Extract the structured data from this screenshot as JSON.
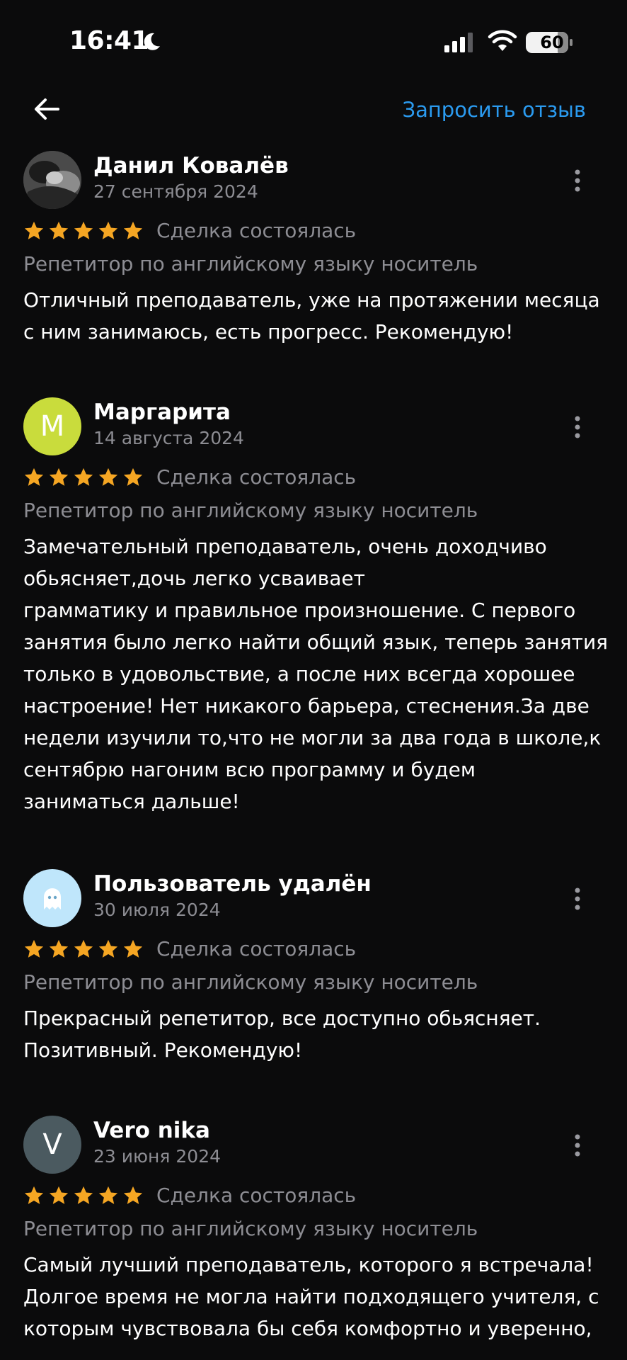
{
  "status_bar": {
    "time": "16:41",
    "battery": "60",
    "icons": [
      "moon-icon",
      "signal-icon",
      "wifi-icon",
      "battery-icon"
    ]
  },
  "header": {
    "back_icon": "arrow-left-icon",
    "request_review": "Запросить отзыв",
    "accent_color": "#2b9bf0"
  },
  "colors": {
    "background": "#0b0b0c",
    "star": "#f5a623",
    "muted_text": "#8d8d93"
  },
  "reviews": [
    {
      "author": "Данил Ковалёв",
      "date": "27 сентября 2024",
      "rating": 5,
      "deal_status": "Сделка состоялась",
      "category": "Репетитор по английскому языку носитель",
      "text": "Отличный преподаватель, уже на протяжении месяца\nс ним занимаюсь, есть прогресс. Рекомендую!",
      "avatar_type": "photo"
    },
    {
      "author": "Маргарита",
      "date": "14 августа 2024",
      "rating": 5,
      "deal_status": "Сделка состоялась",
      "category": "Репетитор по английскому языку носитель",
      "text": "Замечательный преподаватель, очень доходчиво\nобьясняет,дочь легко усваивает\nграмматику и правильное произношение. С первого\nзанятия было легко найти общий язык, теперь занятия\nтолько в удовольствие, а после них всегда хорошее\nнастроение! Нет никакого барьера, стеснения.За две\nнедели изучили то,что не могли за два года в школе,к\nсентябрю нагоним всю программу и будем\nзаниматься дальше!",
      "avatar_letter": "M",
      "avatar_color": "#c9dc3c"
    },
    {
      "author": "Пользователь удалён",
      "date": "30 июля 2024",
      "rating": 5,
      "deal_status": "Сделка состоялась",
      "category": "Репетитор по английскому языку носитель",
      "text": "Прекрасный репетитор, все доступно обьясняет.\nПозитивный. Рекомендую!",
      "avatar_type": "ghost-icon",
      "avatar_color": "#bfe6fb"
    },
    {
      "author": "Vero nika",
      "date": "23 июня 2024",
      "rating": 5,
      "deal_status": "Сделка состоялась",
      "category": "Репетитор по английскому языку носитель",
      "text": "Самый лучший преподаватель, которого я встречала!\nДолгое время не могла найти подходящего учителя, с\nкоторым чувствовала бы себя комфортно и уверенно,",
      "avatar_letter": "V",
      "avatar_color": "#4b5a60"
    }
  ]
}
